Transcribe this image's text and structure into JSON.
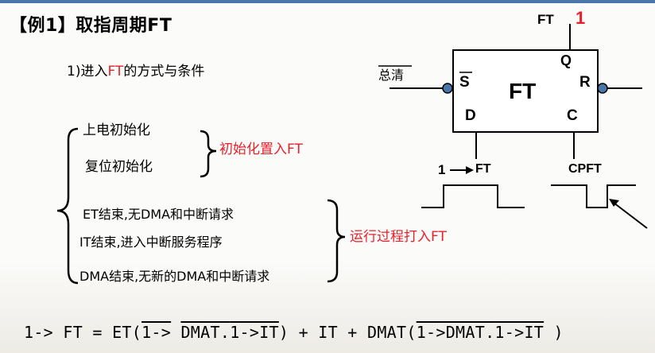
{
  "title": "【例1】取指周期FT",
  "subtitle": {
    "prefix": "1)进入",
    "red": "FT",
    "suffix": "的方式与条件"
  },
  "groups": {
    "init": {
      "items": [
        "上电初始化",
        "复位初始化"
      ],
      "result": "初始化置入FT"
    },
    "run": {
      "items": [
        "ET结束,无DMA和中断请求",
        "IT结束,进入中断服务程序",
        "DMA结束,无新的DMA和中断请求"
      ],
      "result": "运行过程打入FT"
    }
  },
  "flipflop": {
    "name": "FT",
    "pins": {
      "s": "S",
      "r": "R",
      "q": "Q",
      "d": "D",
      "c": "C"
    },
    "clear_label": "总清",
    "q_output": "FT",
    "q_value": "1",
    "d_input_label": "1",
    "d_input_name": "FT",
    "clock_label": "CPFT"
  },
  "formula": {
    "lhs": "1-> FT = ET(",
    "n1": "1->",
    "n2": "DMAT.",
    "n3": "1->IT",
    "mid": ") + IT + DMAT(",
    "n4": "1->DMAT.",
    "n5": "1->IT",
    "end": ")"
  },
  "colors": {
    "red": "#e8202a",
    "accent": "#4a77a8"
  }
}
